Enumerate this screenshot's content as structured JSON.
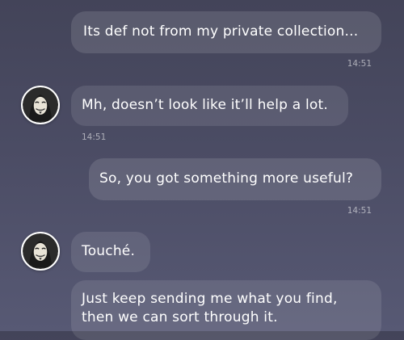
{
  "messages": [
    {
      "side": "sent",
      "text": "Its def not from my private collection...",
      "time": "14:51"
    },
    {
      "side": "received",
      "text": "Mh, doesn’t look like it’ll help a lot.",
      "time": "14:51"
    },
    {
      "side": "sent",
      "text": "So, you got something more useful?",
      "time": "14:51"
    },
    {
      "side": "received",
      "text": "Touché."
    },
    {
      "side": "received",
      "text": "Just keep sending me what you find,\nthen we can sort through it."
    }
  ],
  "icons": {
    "avatar": "guy-fawkes-mask-avatar-icon"
  },
  "colors": {
    "background_top": "#434459",
    "background_bottom": "#575974",
    "bubble": "rgba(255,255,255,0.10)",
    "text": "#ffffff",
    "timestamp": "rgba(255,255,255,0.55)"
  }
}
